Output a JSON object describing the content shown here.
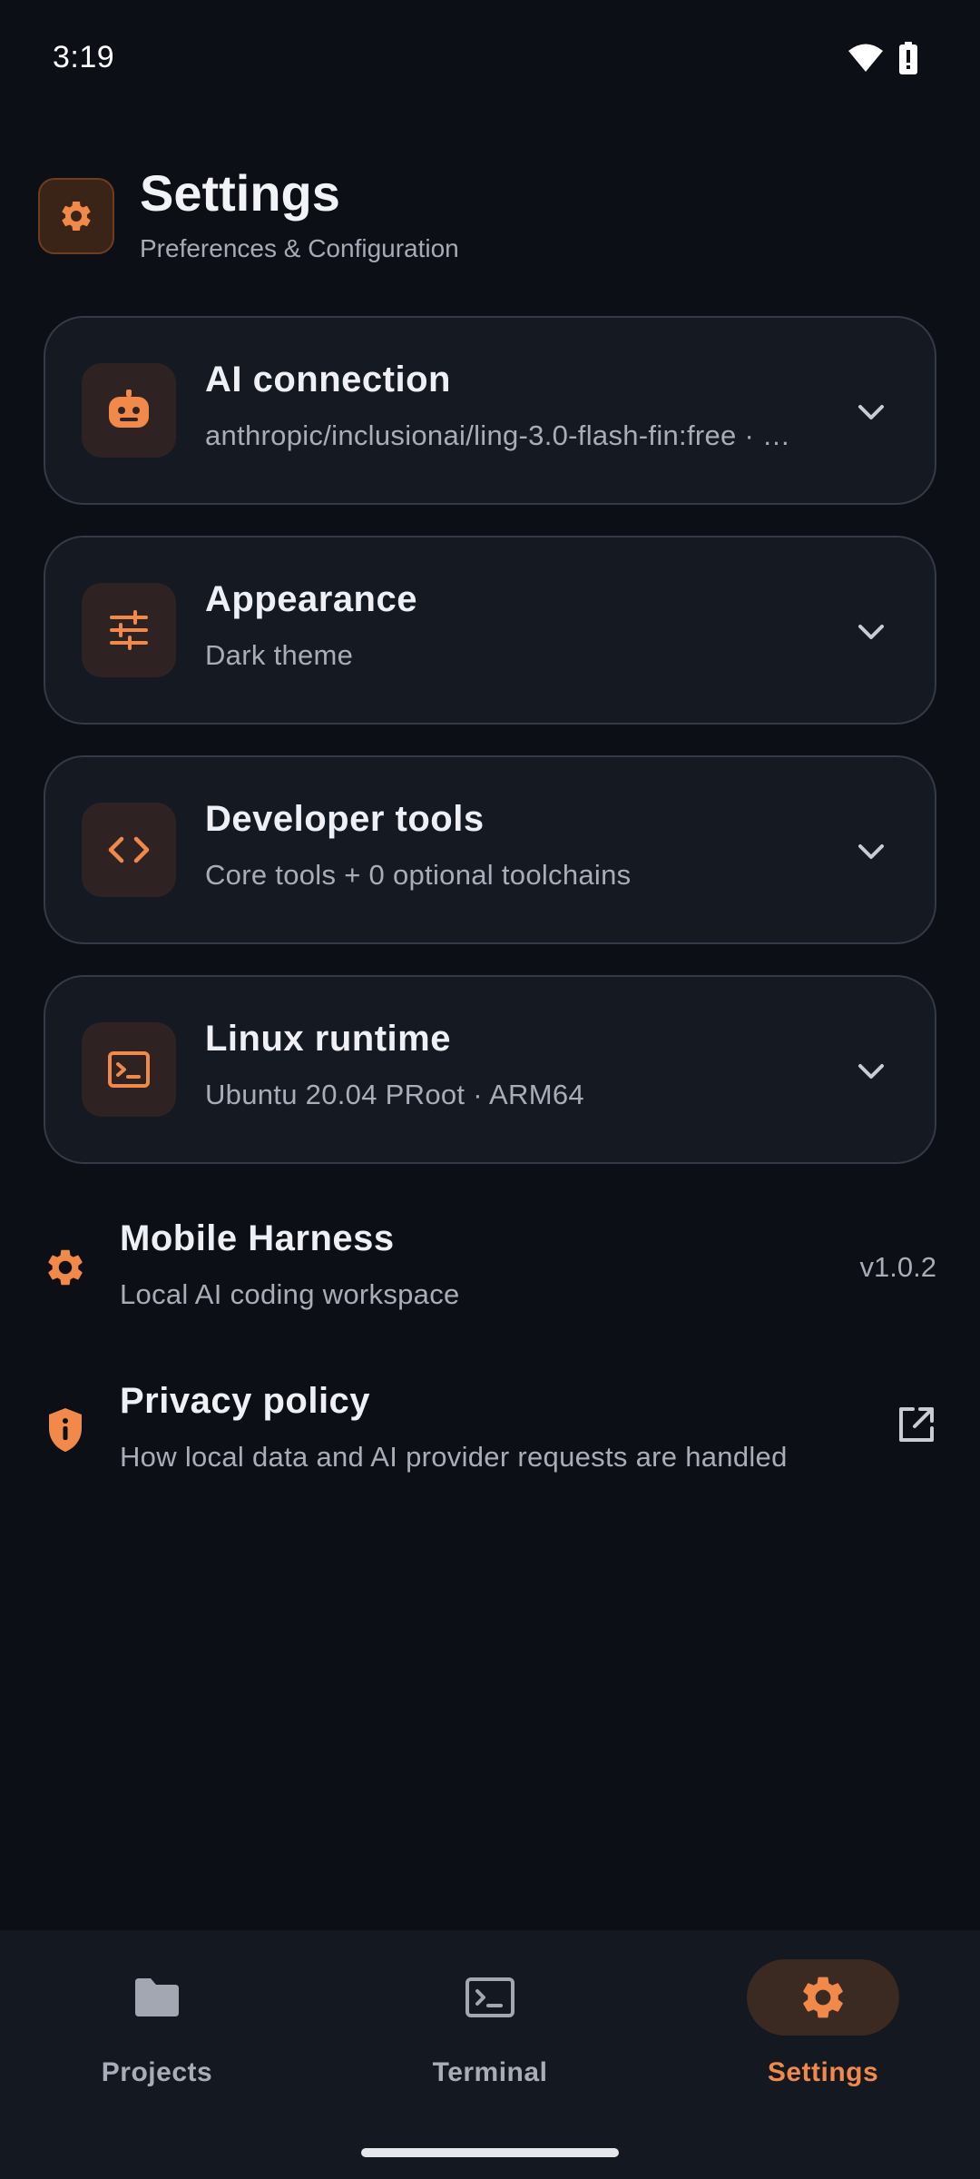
{
  "status_bar": {
    "time": "3:19"
  },
  "header": {
    "title": "Settings",
    "subtitle": "Preferences & Configuration",
    "icon": "gear-icon"
  },
  "cards": [
    {
      "title": "AI connection",
      "subtitle": "anthropic/inclusionai/ling-3.0-flash-fin:free · …",
      "icon": "robot-icon"
    },
    {
      "title": "Appearance",
      "subtitle": "Dark theme",
      "icon": "sliders-icon"
    },
    {
      "title": "Developer tools",
      "subtitle": "Core tools + 0 optional toolchains",
      "icon": "code-icon"
    },
    {
      "title": "Linux runtime",
      "subtitle": "Ubuntu 20.04 PRoot · ARM64",
      "icon": "terminal-icon"
    }
  ],
  "about": {
    "title": "Mobile Harness",
    "subtitle": "Local AI coding workspace",
    "version": "v1.0.2",
    "icon": "gear-icon"
  },
  "privacy": {
    "title": "Privacy policy",
    "subtitle": "How local data and AI provider requests are handled",
    "icon": "shield-icon",
    "trail_icon": "open-external-icon"
  },
  "nav": {
    "items": [
      {
        "label": "Projects",
        "icon": "folder-icon",
        "active": false
      },
      {
        "label": "Terminal",
        "icon": "terminal-icon",
        "active": false
      },
      {
        "label": "Settings",
        "icon": "gear-icon",
        "active": true
      }
    ]
  },
  "colors": {
    "accent": "#f0894a",
    "background": "#0c0f16",
    "card": "#151922",
    "muted": "#a9adb8"
  }
}
